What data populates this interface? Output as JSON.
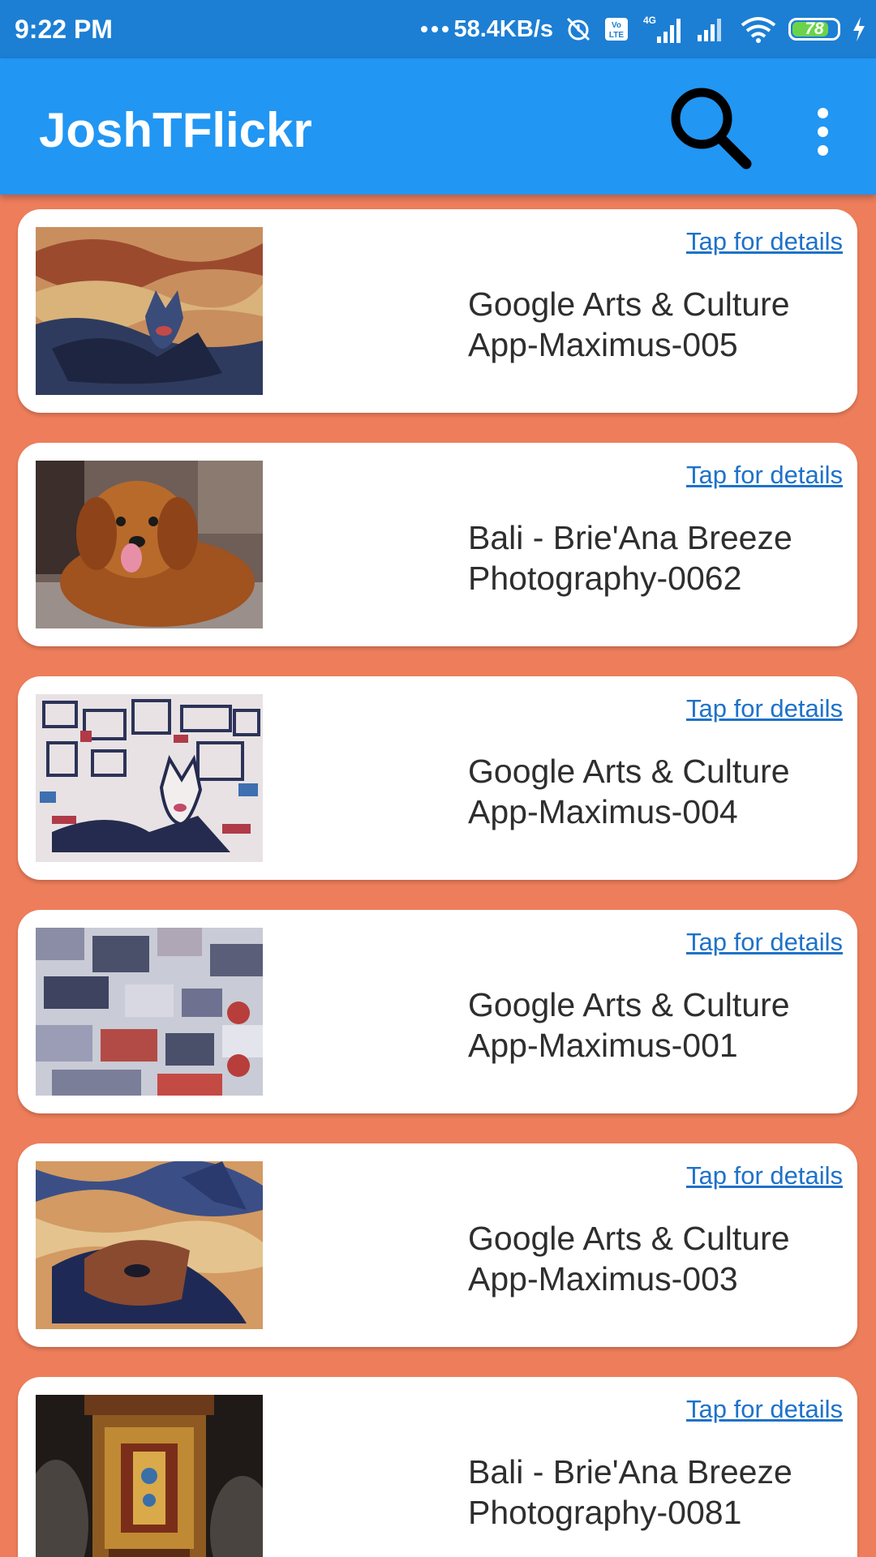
{
  "status_bar": {
    "time": "9:22 PM",
    "net_speed": "58.4KB/s",
    "volte": "VoLTE",
    "network_type": "4G",
    "battery_level": "78"
  },
  "app_bar": {
    "title": "JoshTFlickr",
    "search_icon": "search-icon",
    "menu_icon": "more-vert-icon"
  },
  "photos": [
    {
      "link_text": "Tap for details",
      "title": "Google Arts & Culture App-Maximus-005",
      "image": "dog-painting-thumbnail"
    },
    {
      "link_text": "Tap for details",
      "title": "Bali - Brie'Ana Breeze Photography-0062",
      "image": "brown-dog-thumbnail"
    },
    {
      "link_text": "Tap for details",
      "title": "Google Arts & Culture App-Maximus-004",
      "image": "dog-abstract-thumbnail"
    },
    {
      "link_text": "Tap for details",
      "title": "Google Arts & Culture App-Maximus-001",
      "image": "abstract-shapes-thumbnail"
    },
    {
      "link_text": "Tap for details",
      "title": "Google Arts & Culture App-Maximus-003",
      "image": "dog-closeup-painting-thumbnail"
    },
    {
      "link_text": "Tap for details",
      "title": "Bali - Brie'Ana Breeze Photography-0081",
      "image": "shrine-thumbnail"
    }
  ],
  "colors": {
    "status_bar": "#1C7FD4",
    "app_bar": "#2196F3",
    "background": "#EE7E5B",
    "link": "#1E72C9"
  }
}
